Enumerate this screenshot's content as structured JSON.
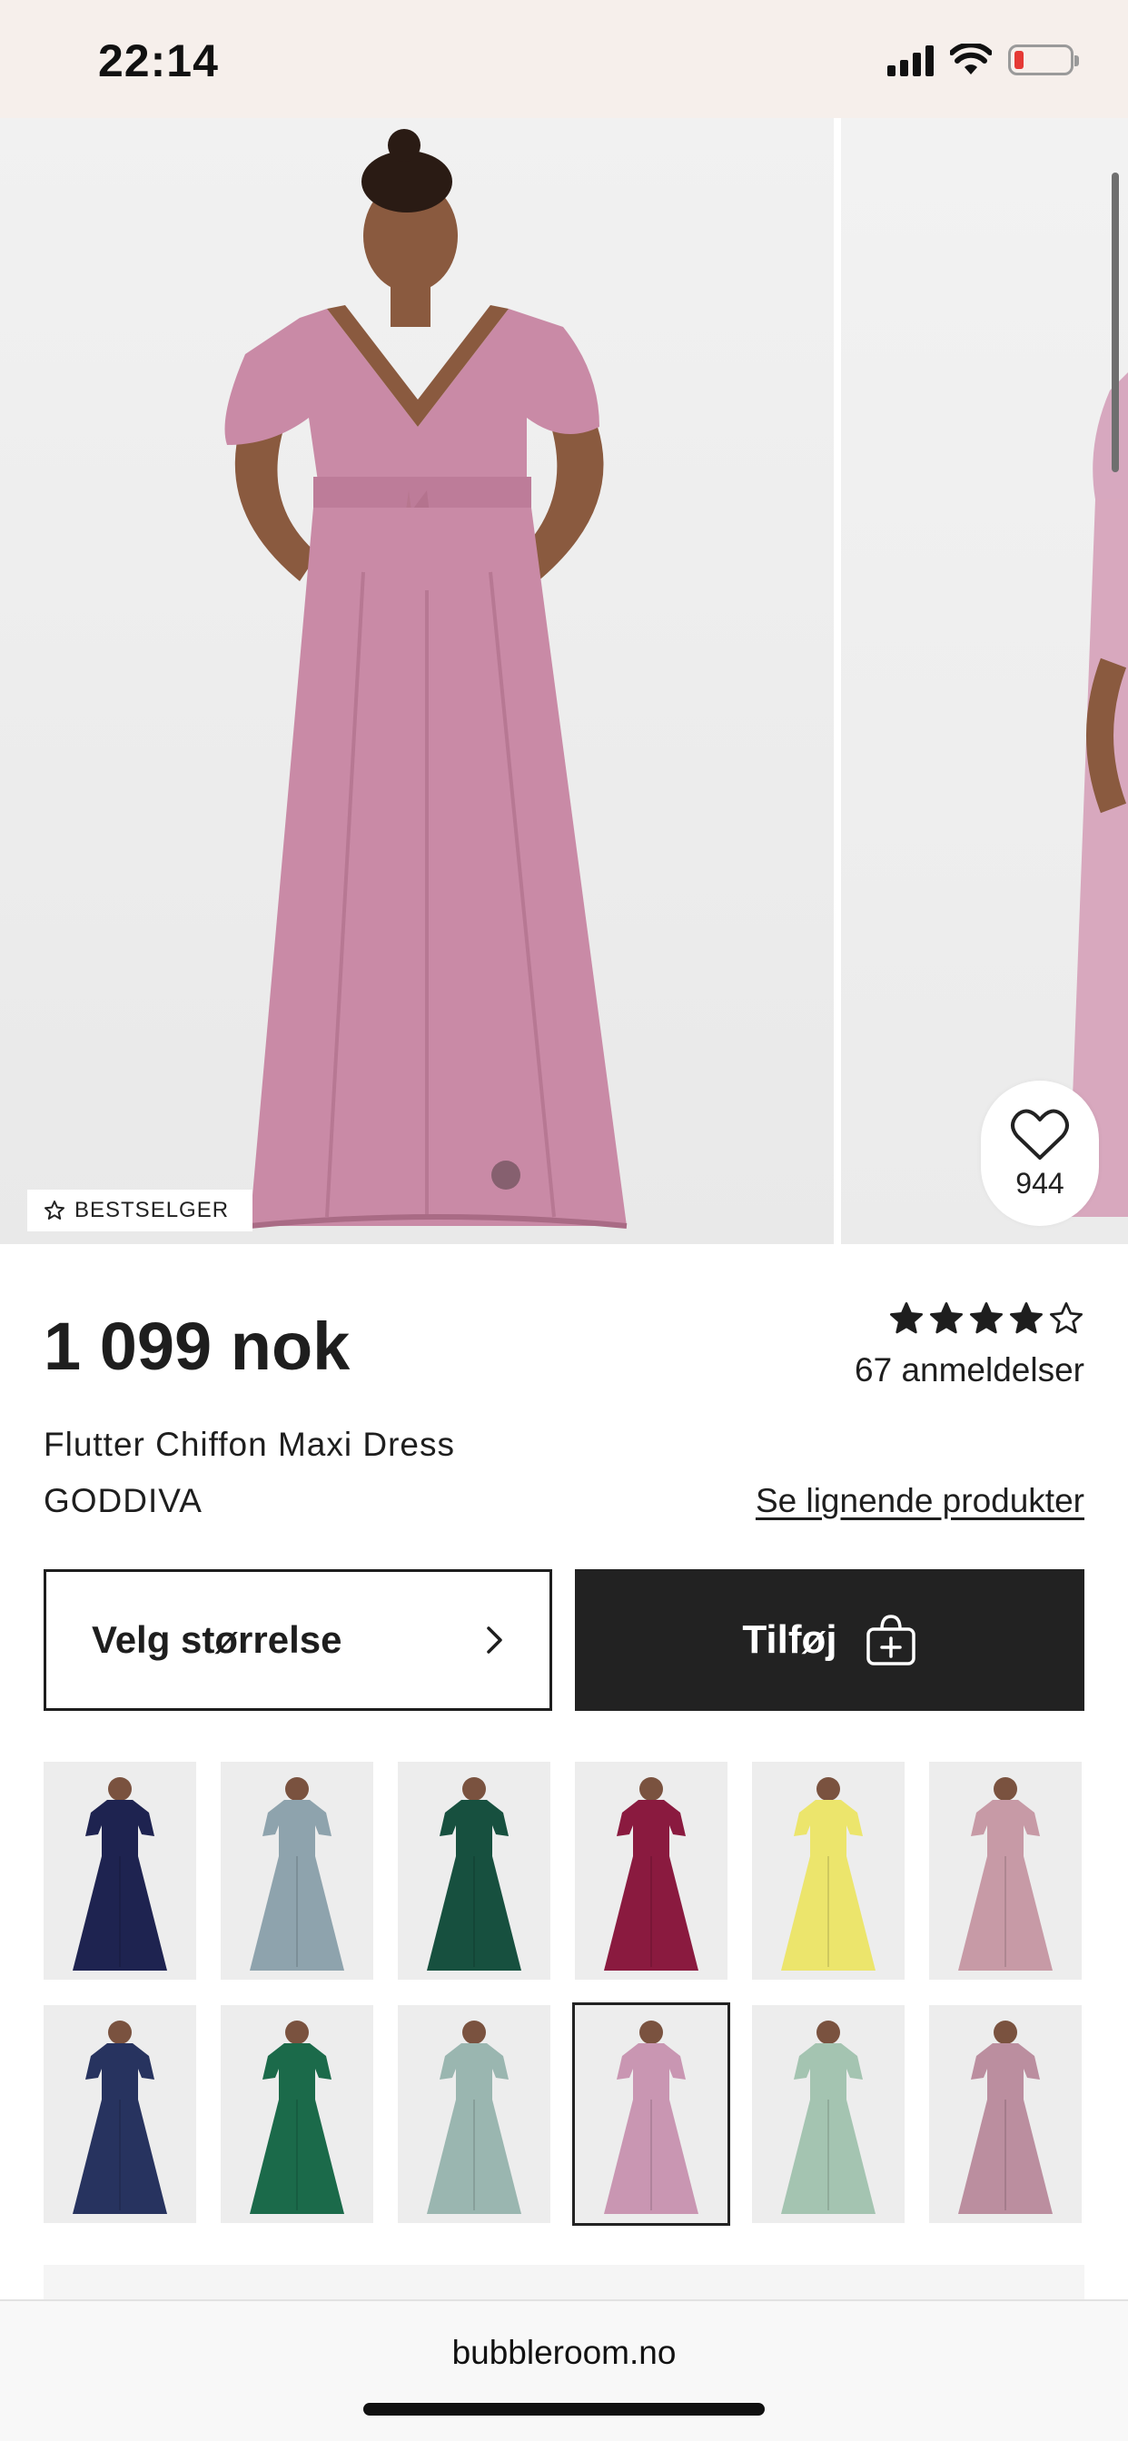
{
  "status_bar": {
    "time": "22:14",
    "battery_color": "#e53935"
  },
  "gallery": {
    "badge": {
      "icon": "star-outline-icon",
      "label": "BESTSELGER"
    },
    "favorite": {
      "icon": "heart-icon",
      "count": "944"
    },
    "dress_color": "#c98aa6"
  },
  "product": {
    "price": "1 099 nok",
    "rating": {
      "value": 4,
      "max": 5
    },
    "reviews": "67 anmeldelser",
    "name": "Flutter Chiffon Maxi Dress",
    "brand": "GODDIVA",
    "similar_link": "Se lignende produkter"
  },
  "actions": {
    "size_button": {
      "label": "Velg størrelse",
      "icon": "chevron-right-icon"
    },
    "add_button": {
      "label": "Tilføj",
      "icon": "bag-plus-icon"
    }
  },
  "color_swatches": [
    {
      "color": "#1e2350",
      "selected": false
    },
    {
      "color": "#8ea3ad",
      "selected": false
    },
    {
      "color": "#17503f",
      "selected": false
    },
    {
      "color": "#8a1a3f",
      "selected": false
    },
    {
      "color": "#ece56c",
      "selected": false
    },
    {
      "color": "#c79aa6",
      "selected": false
    },
    {
      "color": "#27335f",
      "selected": false
    },
    {
      "color": "#1b6a4a",
      "selected": false
    },
    {
      "color": "#9ab6b0",
      "selected": false
    },
    {
      "color": "#c996b2",
      "selected": true
    },
    {
      "color": "#a4c4b1",
      "selected": false
    },
    {
      "color": "#bb8e9f",
      "selected": false
    }
  ],
  "browser": {
    "url": "bubbleroom.no"
  }
}
